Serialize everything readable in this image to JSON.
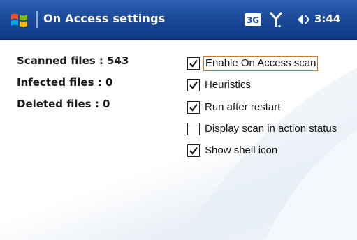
{
  "titlebar": {
    "icon": "windows-flag-icon",
    "title": "On Access settings",
    "status": {
      "network": "3G",
      "network_icon": "network-3g-icon",
      "signal_icon": "signal-antenna-icon",
      "volume_icon": "speaker-volume-icon",
      "time": "3:44"
    }
  },
  "stats": {
    "scanned": "Scanned files : 543",
    "infected": "Infected files : 0",
    "deleted": "Deleted files : 0"
  },
  "options": [
    {
      "label": "Enable On Access scan",
      "checked": true,
      "focused": true
    },
    {
      "label": "Heuristics",
      "checked": true,
      "focused": false
    },
    {
      "label": "Run after restart",
      "checked": true,
      "focused": false
    },
    {
      "label": "Display scan in action status",
      "checked": false,
      "focused": false
    },
    {
      "label": "Show shell icon",
      "checked": true,
      "focused": false
    }
  ],
  "colors": {
    "titlebar": "#1c4a9a",
    "focus_border": "#e0741a",
    "text": "#111111"
  }
}
